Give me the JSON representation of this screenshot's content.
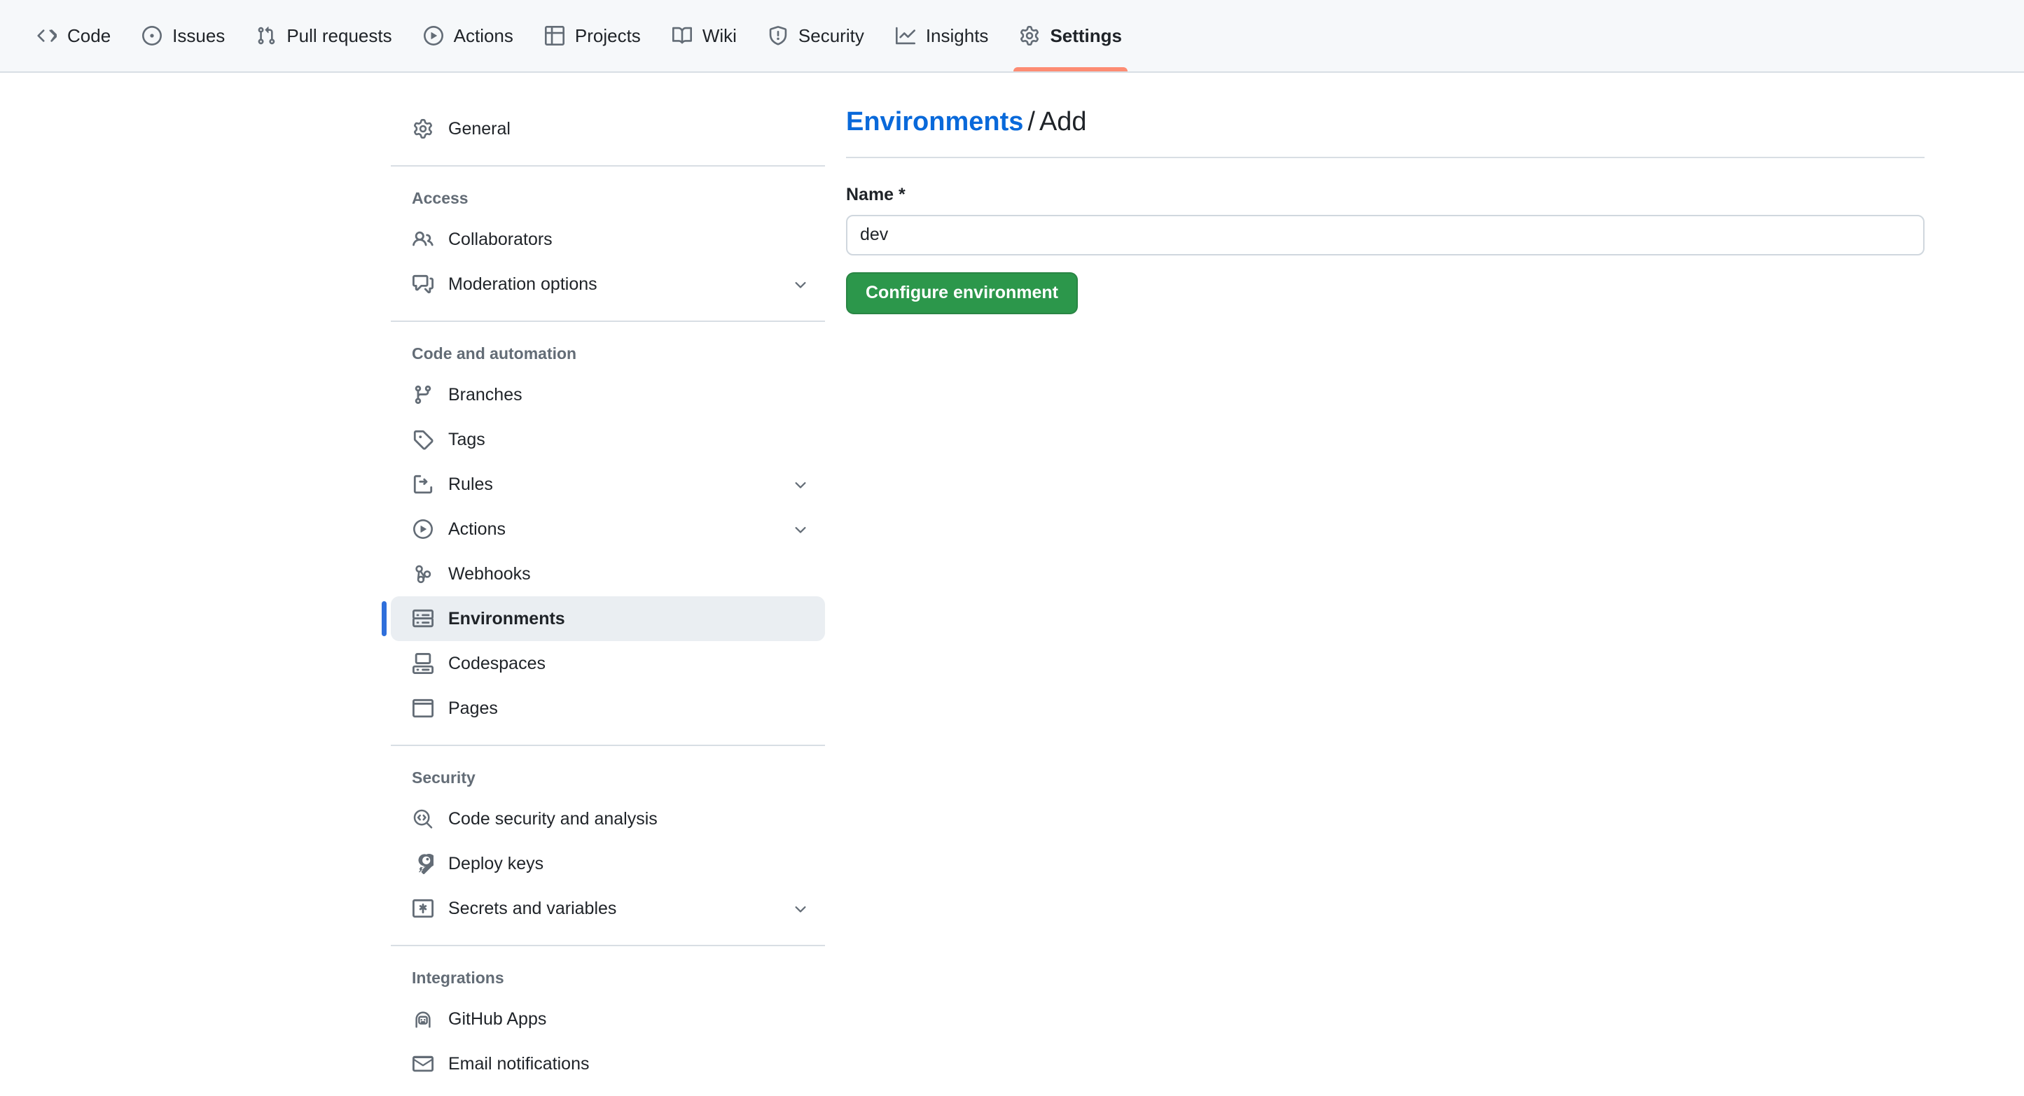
{
  "topnav": {
    "items": [
      {
        "label": "Code",
        "icon": "code-icon",
        "active": false
      },
      {
        "label": "Issues",
        "icon": "issue-opened-icon",
        "active": false
      },
      {
        "label": "Pull requests",
        "icon": "git-pull-request-icon",
        "active": false
      },
      {
        "label": "Actions",
        "icon": "play-icon",
        "active": false
      },
      {
        "label": "Projects",
        "icon": "table-icon",
        "active": false
      },
      {
        "label": "Wiki",
        "icon": "book-icon",
        "active": false
      },
      {
        "label": "Security",
        "icon": "shield-icon",
        "active": false
      },
      {
        "label": "Insights",
        "icon": "graph-icon",
        "active": false
      },
      {
        "label": "Settings",
        "icon": "gear-icon",
        "active": true
      }
    ],
    "active_underline_color": "#fd8c73"
  },
  "sidebar": {
    "selected_indicator_color": "#2f6fdb",
    "groups": [
      {
        "heading": null,
        "items": [
          {
            "label": "General",
            "icon": "gear-icon",
            "chevron": false,
            "selected": false
          }
        ]
      },
      {
        "heading": "Access",
        "items": [
          {
            "label": "Collaborators",
            "icon": "people-icon",
            "chevron": false,
            "selected": false
          },
          {
            "label": "Moderation options",
            "icon": "comment-discussion-icon",
            "chevron": true,
            "selected": false
          }
        ]
      },
      {
        "heading": "Code and automation",
        "items": [
          {
            "label": "Branches",
            "icon": "git-branch-icon",
            "chevron": false,
            "selected": false
          },
          {
            "label": "Tags",
            "icon": "tag-icon",
            "chevron": false,
            "selected": false
          },
          {
            "label": "Rules",
            "icon": "ruleset-icon",
            "chevron": true,
            "selected": false
          },
          {
            "label": "Actions",
            "icon": "play-icon",
            "chevron": true,
            "selected": false
          },
          {
            "label": "Webhooks",
            "icon": "webhook-icon",
            "chevron": false,
            "selected": false
          },
          {
            "label": "Environments",
            "icon": "server-icon",
            "chevron": false,
            "selected": true
          },
          {
            "label": "Codespaces",
            "icon": "codespaces-icon",
            "chevron": false,
            "selected": false
          },
          {
            "label": "Pages",
            "icon": "browser-icon",
            "chevron": false,
            "selected": false
          }
        ]
      },
      {
        "heading": "Security",
        "items": [
          {
            "label": "Code security and analysis",
            "icon": "codescan-icon",
            "chevron": false,
            "selected": false
          },
          {
            "label": "Deploy keys",
            "icon": "key-icon",
            "chevron": false,
            "selected": false
          },
          {
            "label": "Secrets and variables",
            "icon": "key-asterisk-icon",
            "chevron": true,
            "selected": false
          }
        ]
      },
      {
        "heading": "Integrations",
        "items": [
          {
            "label": "GitHub Apps",
            "icon": "apps-icon",
            "chevron": false,
            "selected": false
          },
          {
            "label": "Email notifications",
            "icon": "mail-icon",
            "chevron": false,
            "selected": false
          }
        ]
      }
    ]
  },
  "main": {
    "breadcrumb": {
      "link": "Environments",
      "separator": "/",
      "current": "Add"
    },
    "form": {
      "name_label": "Name *",
      "name_value": "dev",
      "name_placeholder": "",
      "submit_label": "Configure environment",
      "submit_color": "#2c974b"
    }
  }
}
